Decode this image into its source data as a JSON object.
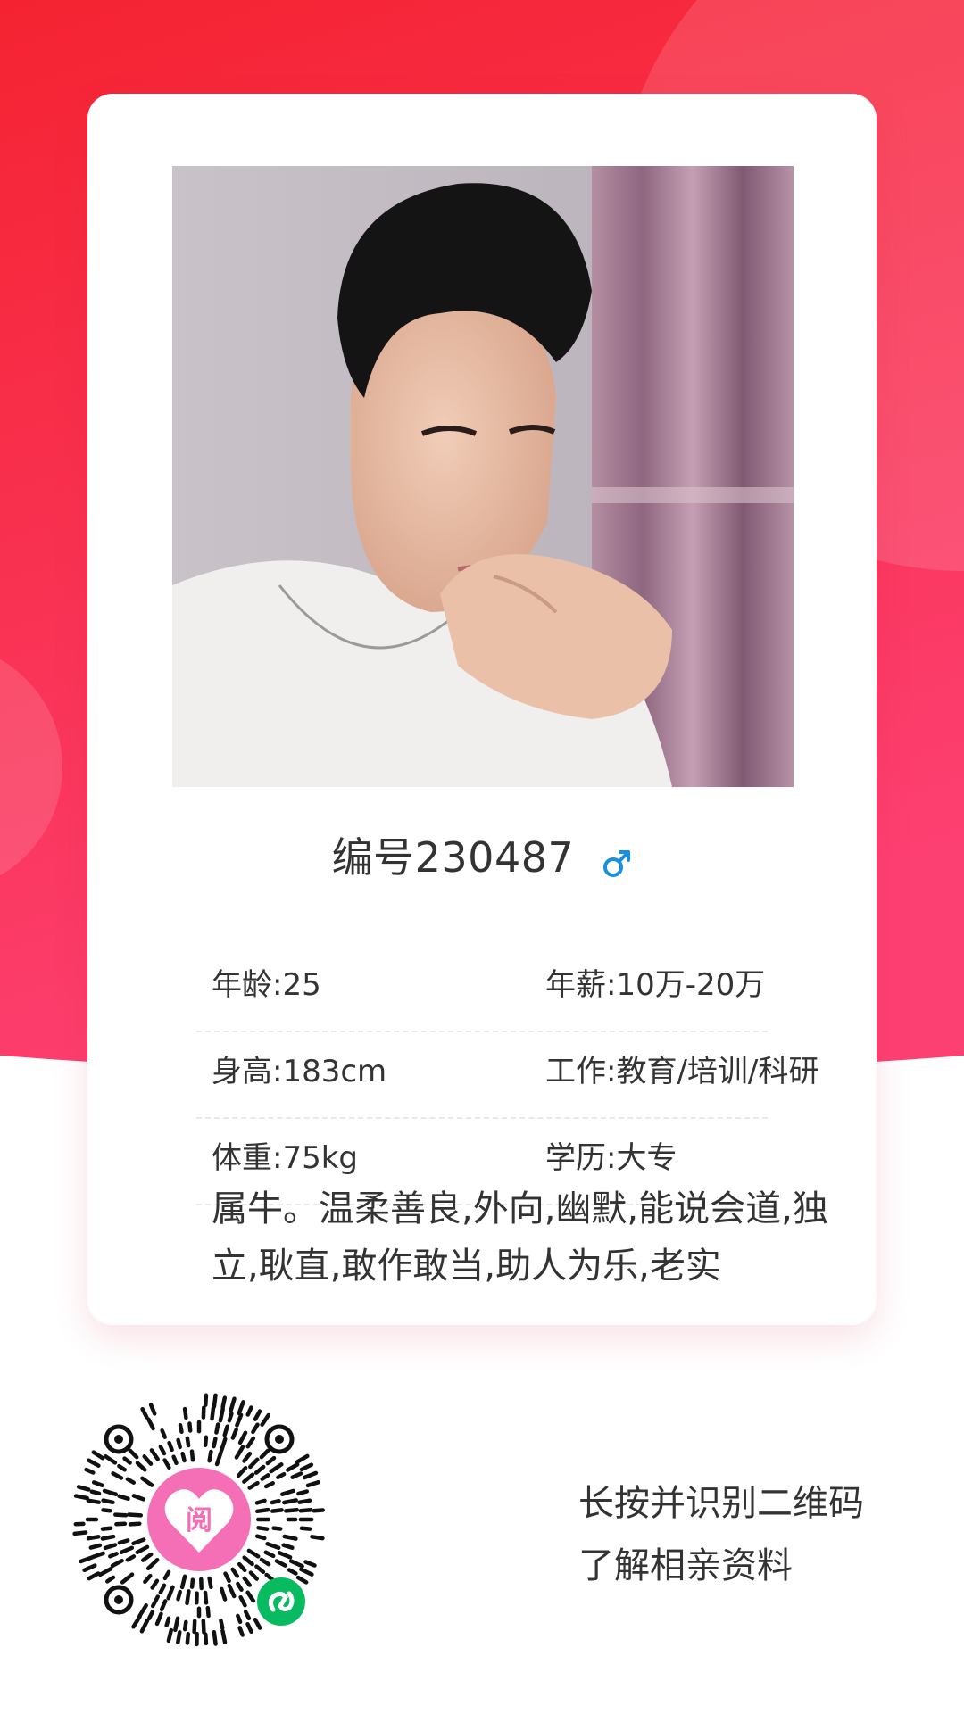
{
  "theme": {
    "primary": "#f82a40",
    "gradient_top": "#f52331",
    "gradient_bottom": "#fd4072",
    "gender_icon_color": "#1a8fe0",
    "mini_program_green": "#09bb60",
    "qr_logo_pink": "#f46fb5"
  },
  "profile": {
    "photo_alt": "profile-photo",
    "member_id": "编号230487",
    "gender_icon": "male-icon",
    "details": [
      {
        "left": "年龄:25",
        "right": "年薪:10万-20万"
      },
      {
        "left": "身高:183cm",
        "right": "工作:教育/培训/科研"
      },
      {
        "left": "体重:75kg",
        "right": "学历:大专"
      }
    ],
    "bio": "属牛。温柔善良,外向,幽默,能说会道,独立,耿直,敢作敢当,助人为乐,老实"
  },
  "qr": {
    "logo_glyph": "阅",
    "badge_icon": "mini-program-icon",
    "caption_line1": "长按并识别二维码",
    "caption_line2": "了解相亲资料"
  }
}
